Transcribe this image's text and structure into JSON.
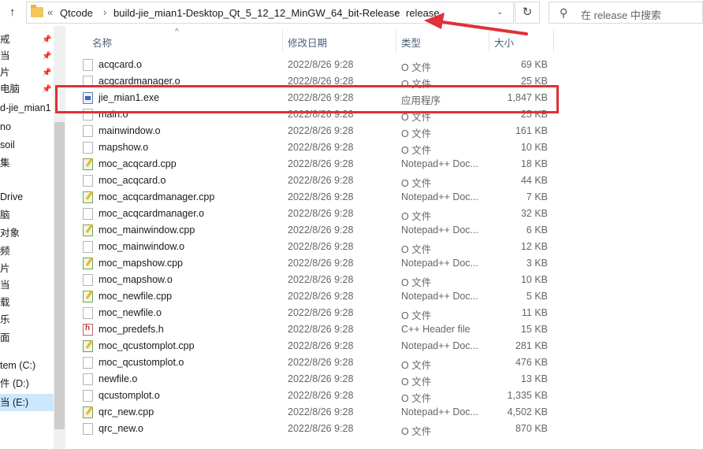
{
  "toolbar": {
    "up_icon": "arrow-up-icon"
  },
  "address": {
    "prefix": "«",
    "crumbs": [
      "Qtcode",
      "build-jie_mian1-Desktop_Qt_5_12_12_MinGW_64_bit-Release",
      "release"
    ],
    "separator": "›"
  },
  "search": {
    "placeholder": "在 release 中搜索"
  },
  "sidebar": {
    "items": [
      {
        "label": "戒",
        "pinned": true
      },
      {
        "label": "当",
        "pinned": true
      },
      {
        "label": "片",
        "pinned": true
      },
      {
        "label": "电脑",
        "pinned": true
      },
      {
        "label": "d-jie_mian1",
        "pinned": false
      },
      {
        "label": "no",
        "pinned": false
      },
      {
        "label": "soil",
        "pinned": false
      },
      {
        "label": "集",
        "pinned": false
      },
      {
        "label": "Drive",
        "pinned": false
      },
      {
        "label": "脑",
        "pinned": false
      },
      {
        "label": "对象",
        "pinned": false
      },
      {
        "label": "频",
        "pinned": false
      },
      {
        "label": "片",
        "pinned": false
      },
      {
        "label": "当",
        "pinned": false
      },
      {
        "label": "载",
        "pinned": false
      },
      {
        "label": "乐",
        "pinned": false
      },
      {
        "label": "面",
        "pinned": false
      },
      {
        "label": "tem (C:)",
        "pinned": false
      },
      {
        "label": "件 (D:)",
        "pinned": false
      },
      {
        "label": "当 (E:)",
        "pinned": false
      }
    ]
  },
  "columns": {
    "name": "名称",
    "date": "修改日期",
    "type": "类型",
    "size": "大小"
  },
  "files": [
    {
      "name": "acqcard.o",
      "date": "2022/8/26 9:28",
      "type": "O 文件",
      "size": "69 KB",
      "icon": "generic"
    },
    {
      "name": "acqcardmanager.o",
      "date": "2022/8/26 9:28",
      "type": "O 文件",
      "size": "25 KB",
      "icon": "generic"
    },
    {
      "name": "jie_mian1.exe",
      "date": "2022/8/26 9:28",
      "type": "应用程序",
      "size": "1,847 KB",
      "icon": "exe"
    },
    {
      "name": "main.o",
      "date": "2022/8/26 9:28",
      "type": "O 文件",
      "size": "25 KB",
      "icon": "generic"
    },
    {
      "name": "mainwindow.o",
      "date": "2022/8/26 9:28",
      "type": "O 文件",
      "size": "161 KB",
      "icon": "generic"
    },
    {
      "name": "mapshow.o",
      "date": "2022/8/26 9:28",
      "type": "O 文件",
      "size": "10 KB",
      "icon": "generic"
    },
    {
      "name": "moc_acqcard.cpp",
      "date": "2022/8/26 9:28",
      "type": "Notepad++ Doc...",
      "size": "18 KB",
      "icon": "npp"
    },
    {
      "name": "moc_acqcard.o",
      "date": "2022/8/26 9:28",
      "type": "O 文件",
      "size": "44 KB",
      "icon": "generic"
    },
    {
      "name": "moc_acqcardmanager.cpp",
      "date": "2022/8/26 9:28",
      "type": "Notepad++ Doc...",
      "size": "7 KB",
      "icon": "npp"
    },
    {
      "name": "moc_acqcardmanager.o",
      "date": "2022/8/26 9:28",
      "type": "O 文件",
      "size": "32 KB",
      "icon": "generic"
    },
    {
      "name": "moc_mainwindow.cpp",
      "date": "2022/8/26 9:28",
      "type": "Notepad++ Doc...",
      "size": "6 KB",
      "icon": "npp"
    },
    {
      "name": "moc_mainwindow.o",
      "date": "2022/8/26 9:28",
      "type": "O 文件",
      "size": "12 KB",
      "icon": "generic"
    },
    {
      "name": "moc_mapshow.cpp",
      "date": "2022/8/26 9:28",
      "type": "Notepad++ Doc...",
      "size": "3 KB",
      "icon": "npp"
    },
    {
      "name": "moc_mapshow.o",
      "date": "2022/8/26 9:28",
      "type": "O 文件",
      "size": "10 KB",
      "icon": "generic"
    },
    {
      "name": "moc_newfile.cpp",
      "date": "2022/8/26 9:28",
      "type": "Notepad++ Doc...",
      "size": "5 KB",
      "icon": "npp"
    },
    {
      "name": "moc_newfile.o",
      "date": "2022/8/26 9:28",
      "type": "O 文件",
      "size": "11 KB",
      "icon": "generic"
    },
    {
      "name": "moc_predefs.h",
      "date": "2022/8/26 9:28",
      "type": "C++ Header file",
      "size": "15 KB",
      "icon": "header"
    },
    {
      "name": "moc_qcustomplot.cpp",
      "date": "2022/8/26 9:28",
      "type": "Notepad++ Doc...",
      "size": "281 KB",
      "icon": "npp"
    },
    {
      "name": "moc_qcustomplot.o",
      "date": "2022/8/26 9:28",
      "type": "O 文件",
      "size": "476 KB",
      "icon": "generic"
    },
    {
      "name": "newfile.o",
      "date": "2022/8/26 9:28",
      "type": "O 文件",
      "size": "13 KB",
      "icon": "generic"
    },
    {
      "name": "qcustomplot.o",
      "date": "2022/8/26 9:28",
      "type": "O 文件",
      "size": "1,335 KB",
      "icon": "generic"
    },
    {
      "name": "qrc_new.cpp",
      "date": "2022/8/26 9:28",
      "type": "Notepad++ Doc...",
      "size": "4,502 KB",
      "icon": "npp"
    },
    {
      "name": "qrc_new.o",
      "date": "2022/8/26 9:28",
      "type": "O 文件",
      "size": "870 KB",
      "icon": "generic"
    }
  ],
  "annotation_color": "#e0303a"
}
